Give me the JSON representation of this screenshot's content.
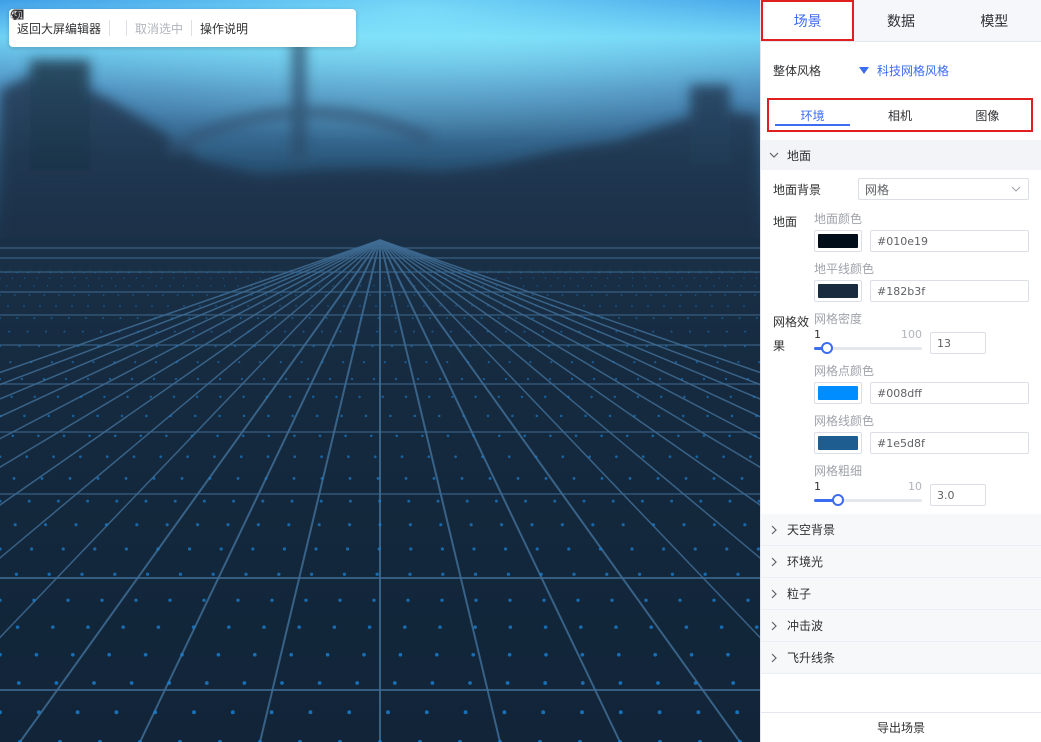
{
  "toolbar": {
    "back_label": "返回大屏编辑器",
    "deselect_label": "取消选中",
    "help_label": "操作说明"
  },
  "top_tabs": [
    {
      "label": "场景",
      "active": true
    },
    {
      "label": "数据",
      "active": false
    },
    {
      "label": "模型",
      "active": false
    }
  ],
  "overall_style": {
    "label": "整体风格",
    "value": "科技网格风格"
  },
  "sub_tabs": [
    {
      "label": "环境",
      "active": true
    },
    {
      "label": "相机",
      "active": false
    },
    {
      "label": "图像",
      "active": false
    }
  ],
  "ground_section": {
    "title": "地面",
    "ground_bg_label": "地面背景",
    "ground_bg_value": "网格",
    "ground_label": "地面",
    "ground_color_label": "地面颜色",
    "ground_color_value": "#010e19",
    "horizon_color_label": "地平线颜色",
    "horizon_color_value": "#182b3f",
    "grid_effect_label": "网格效果",
    "grid_density_label": "网格密度",
    "grid_density_min": "1",
    "grid_density_max": "100",
    "grid_density_value": "13",
    "grid_dot_color_label": "网格点颜色",
    "grid_dot_color_value": "#008dff",
    "grid_line_color_label": "网格线颜色",
    "grid_line_color_value": "#1e5d8f",
    "grid_thickness_label": "网格粗细",
    "grid_thickness_min": "1",
    "grid_thickness_max": "10",
    "grid_thickness_value": "3.0"
  },
  "collapsed_sections": [
    "天空背景",
    "环境光",
    "粒子",
    "冲击波",
    "飞升线条"
  ],
  "export_label": "导出场景",
  "colors": {
    "accent": "#3c6cf0",
    "highlight_border": "#e02020"
  }
}
